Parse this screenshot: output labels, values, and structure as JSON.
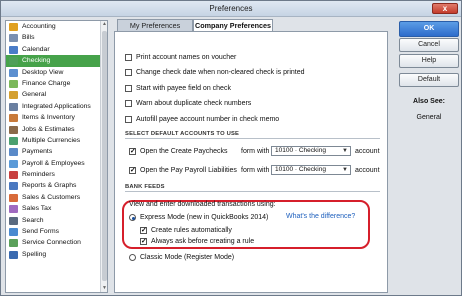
{
  "window": {
    "title": "Preferences",
    "close_glyph": "x"
  },
  "sidebar": {
    "items": [
      {
        "label": "Accounting",
        "icon": "accounting-icon",
        "color": "#e0a020"
      },
      {
        "label": "Bills",
        "icon": "bills-icon",
        "color": "#7a8fb0"
      },
      {
        "label": "Calendar",
        "icon": "calendar-icon",
        "color": "#4a7cc8"
      },
      {
        "label": "Checking",
        "icon": "checking-icon",
        "color": "#4fa05a",
        "selected": true
      },
      {
        "label": "Desktop View",
        "icon": "desktop-view-icon",
        "color": "#5b8fd0"
      },
      {
        "label": "Finance Charge",
        "icon": "finance-charge-icon",
        "color": "#7bb85a"
      },
      {
        "label": "General",
        "icon": "general-icon",
        "color": "#d4a030"
      },
      {
        "label": "Integrated Applications",
        "icon": "integrated-apps-icon",
        "color": "#6a7fa0"
      },
      {
        "label": "Items & Inventory",
        "icon": "items-inventory-icon",
        "color": "#c87a3a"
      },
      {
        "label": "Jobs & Estimates",
        "icon": "jobs-estimates-icon",
        "color": "#8a6a4a"
      },
      {
        "label": "Multiple Currencies",
        "icon": "multiple-currencies-icon",
        "color": "#4aa070"
      },
      {
        "label": "Payments",
        "icon": "payments-icon",
        "color": "#5a8ac8"
      },
      {
        "label": "Payroll & Employees",
        "icon": "payroll-employees-icon",
        "color": "#5a9ad8"
      },
      {
        "label": "Reminders",
        "icon": "reminders-icon",
        "color": "#c84040"
      },
      {
        "label": "Reports & Graphs",
        "icon": "reports-graphs-icon",
        "color": "#4a78c0"
      },
      {
        "label": "Sales & Customers",
        "icon": "sales-customers-icon",
        "color": "#d86a3a"
      },
      {
        "label": "Sales Tax",
        "icon": "sales-tax-icon",
        "color": "#a06ac0"
      },
      {
        "label": "Search",
        "icon": "search-icon",
        "color": "#5a6a80"
      },
      {
        "label": "Send Forms",
        "icon": "send-forms-icon",
        "color": "#4a8ad0"
      },
      {
        "label": "Service Connection",
        "icon": "service-connection-icon",
        "color": "#5aa05a"
      },
      {
        "label": "Spelling",
        "icon": "spelling-icon",
        "color": "#3a6ab0"
      }
    ]
  },
  "tabs": {
    "my_prefs": "My Preferences",
    "company_prefs": "Company Preferences"
  },
  "options": [
    {
      "label": "Print account names on voucher",
      "checked": false
    },
    {
      "label": "Change check date when non-cleared check is printed",
      "checked": false
    },
    {
      "label": "Start with payee field on check",
      "checked": false
    },
    {
      "label": "Warn about duplicate check numbers",
      "checked": false
    },
    {
      "label": "Autofill payee account number in check memo",
      "checked": false
    }
  ],
  "default_accounts": {
    "header": "SELECT DEFAULT ACCOUNTS TO USE",
    "rows": [
      {
        "label": "Open the Create Paychecks",
        "form_with": "form with",
        "value": "10100 · Checking",
        "suffix": "account",
        "checked": true
      },
      {
        "label": "Open the Pay Payroll Liabilities",
        "form_with": "form with",
        "value": "10100 · Checking",
        "suffix": "account",
        "checked": true
      }
    ]
  },
  "bank_feeds": {
    "header": "BANK FEEDS",
    "intro": "View and enter downloaded transactions using:",
    "express_mode": "Express Mode (new in QuickBooks 2014)",
    "whats_diff": "What's the difference?",
    "create_rules": "Create rules automatically",
    "always_ask": "Always ask before creating a rule",
    "classic_mode": "Classic Mode (Register Mode)"
  },
  "buttons": {
    "ok": "OK",
    "cancel": "Cancel",
    "help": "Help",
    "default": "Default"
  },
  "also_see": {
    "title": "Also See:",
    "item": "General"
  },
  "colors": {
    "accent": "#2d6ccb",
    "selection": "#46a24a",
    "highlight": "#d61f2b"
  }
}
